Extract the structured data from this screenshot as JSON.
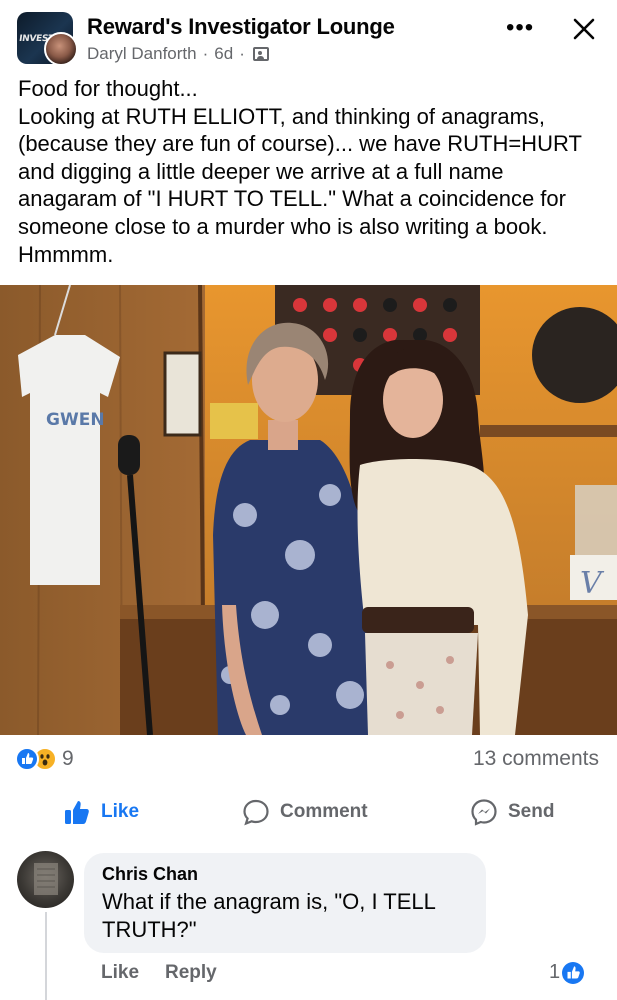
{
  "header": {
    "group_name": "Reward's Investigator Lounge",
    "group_avatar_text": "INVESTI",
    "author": "Daryl Danforth",
    "age": "6d",
    "separator": "·",
    "more_label": "•••"
  },
  "post": {
    "text": "Food for thought...\nLooking at RUTH ELLIOTT, and thinking of anagrams, (because they are fun of course)... we have RUTH=HURT and digging a little deeper we arrive at a full name anagaram of \"I HURT TO TELL.\" What a coincidence for someone close to a murder who is also writing a book. Hmmmm.",
    "photo": {
      "shirt_text": "GWEN",
      "sign_letter": "V"
    }
  },
  "stats": {
    "reaction_count": "9",
    "comments": "13 comments"
  },
  "actions": {
    "like": "Like",
    "comment": "Comment",
    "send": "Send"
  },
  "comment": {
    "author": "Chris Chan",
    "text": "What if the anagram is, \"O, I TELL\nTRUTH?\"",
    "like": "Like",
    "reply": "Reply",
    "reaction_count": "1"
  },
  "colors": {
    "accent": "#1877f2",
    "secondary_text": "#65676b",
    "bubble": "#f0f2f5",
    "wow": "#f7b125"
  }
}
